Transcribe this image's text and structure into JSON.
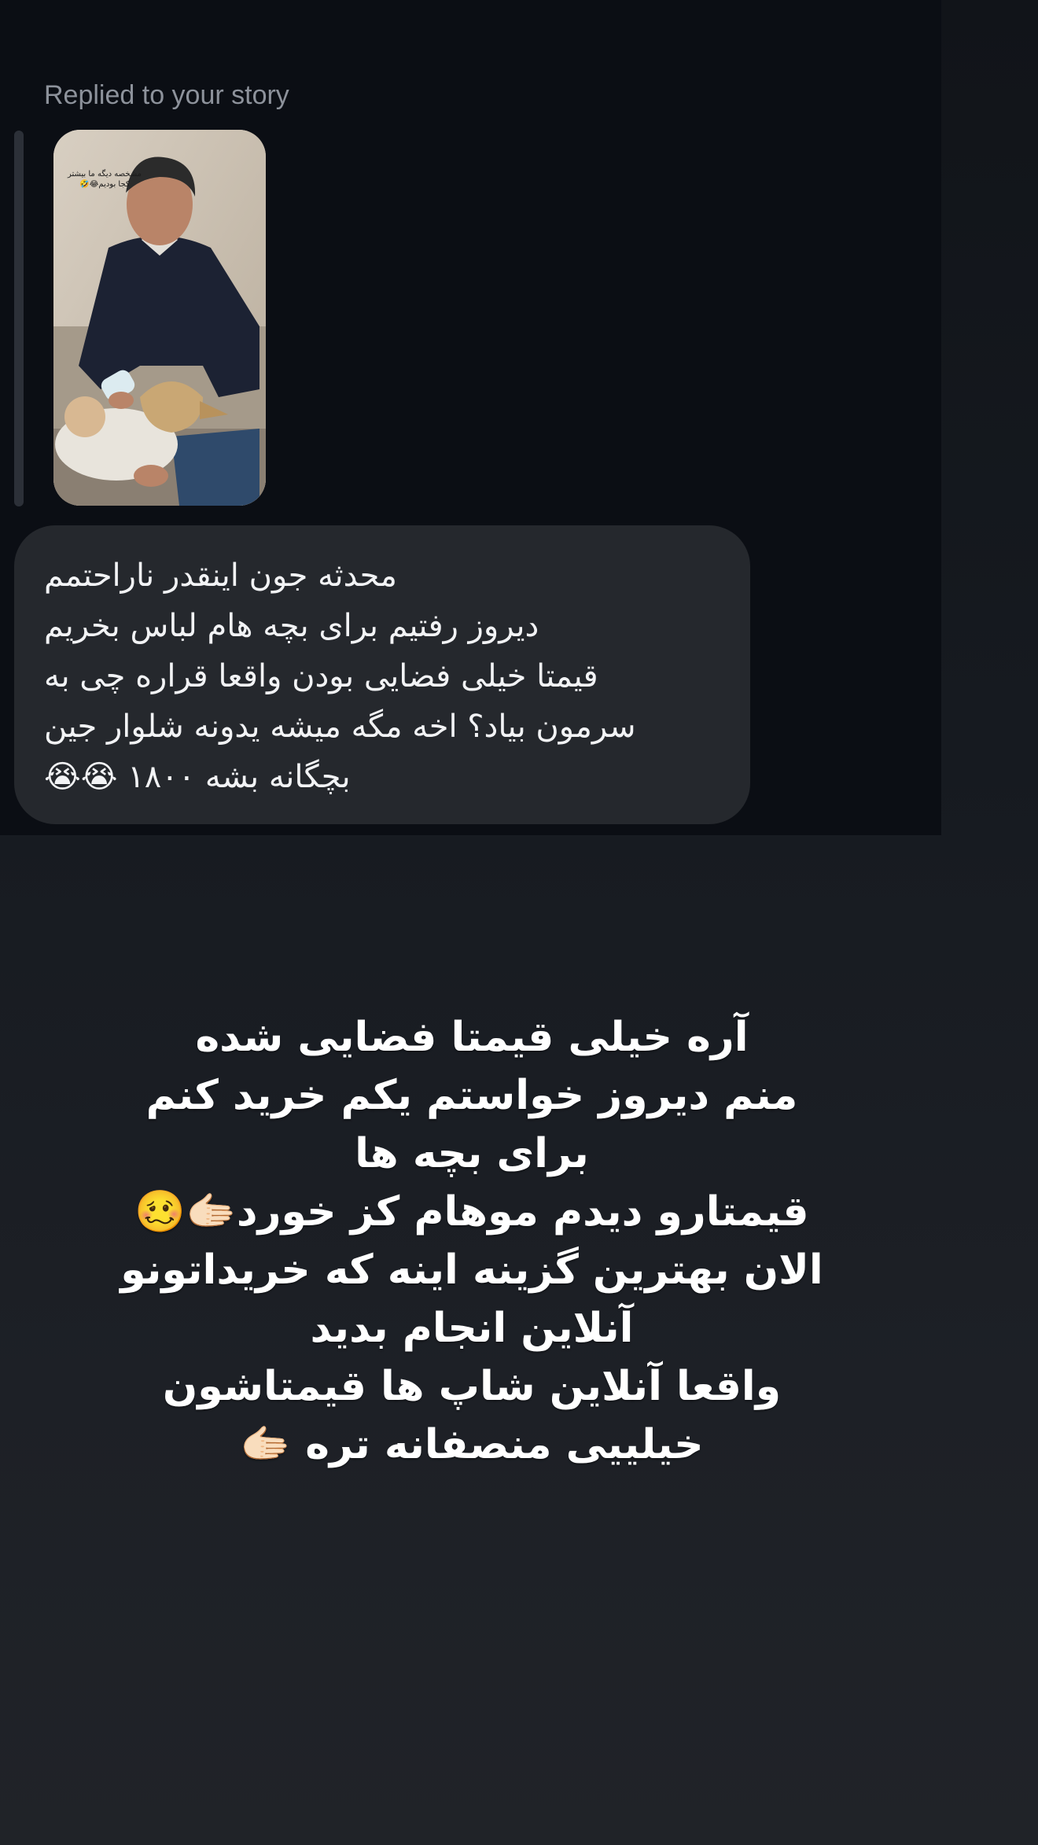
{
  "reply_header": {
    "label": "Replied to your story"
  },
  "story_thumbnail": {
    "caption": "مشخصه دیگه ما بیشتر کجا بودیم😂🤣"
  },
  "message": {
    "text": "محدثه جون اینقدر ناراحتمم\nدیروز رفتیم برای بچه هام لباس بخریم\nقیمتا خیلی فضایی بودن واقعا قراره چی به\nسرمون بیاد؟ اخه مگه میشه یدونه شلوار جین\nبچگانه بشه ۱۸۰۰ 😭😭"
  },
  "response": {
    "text": "آره خیلی قیمتا فضایی شده\nمنم دیروز خواستم یکم خرید کنم\nبرای بچه ها\nقیمتارو دیدم موهام کز خورد🫱🏻🥴\nالان بهترین گزینه اینه که خریداتونو\nآنلاین انجام بدید\nواقعا آنلاین شاپ ها قیمتاشون\nخیلییی منصفانه تره 🫱🏻"
  },
  "colors": {
    "background_dark": "#0b0e14",
    "bubble": "#25282d",
    "label_gray": "#8d929b",
    "text_white": "#ffffff"
  }
}
